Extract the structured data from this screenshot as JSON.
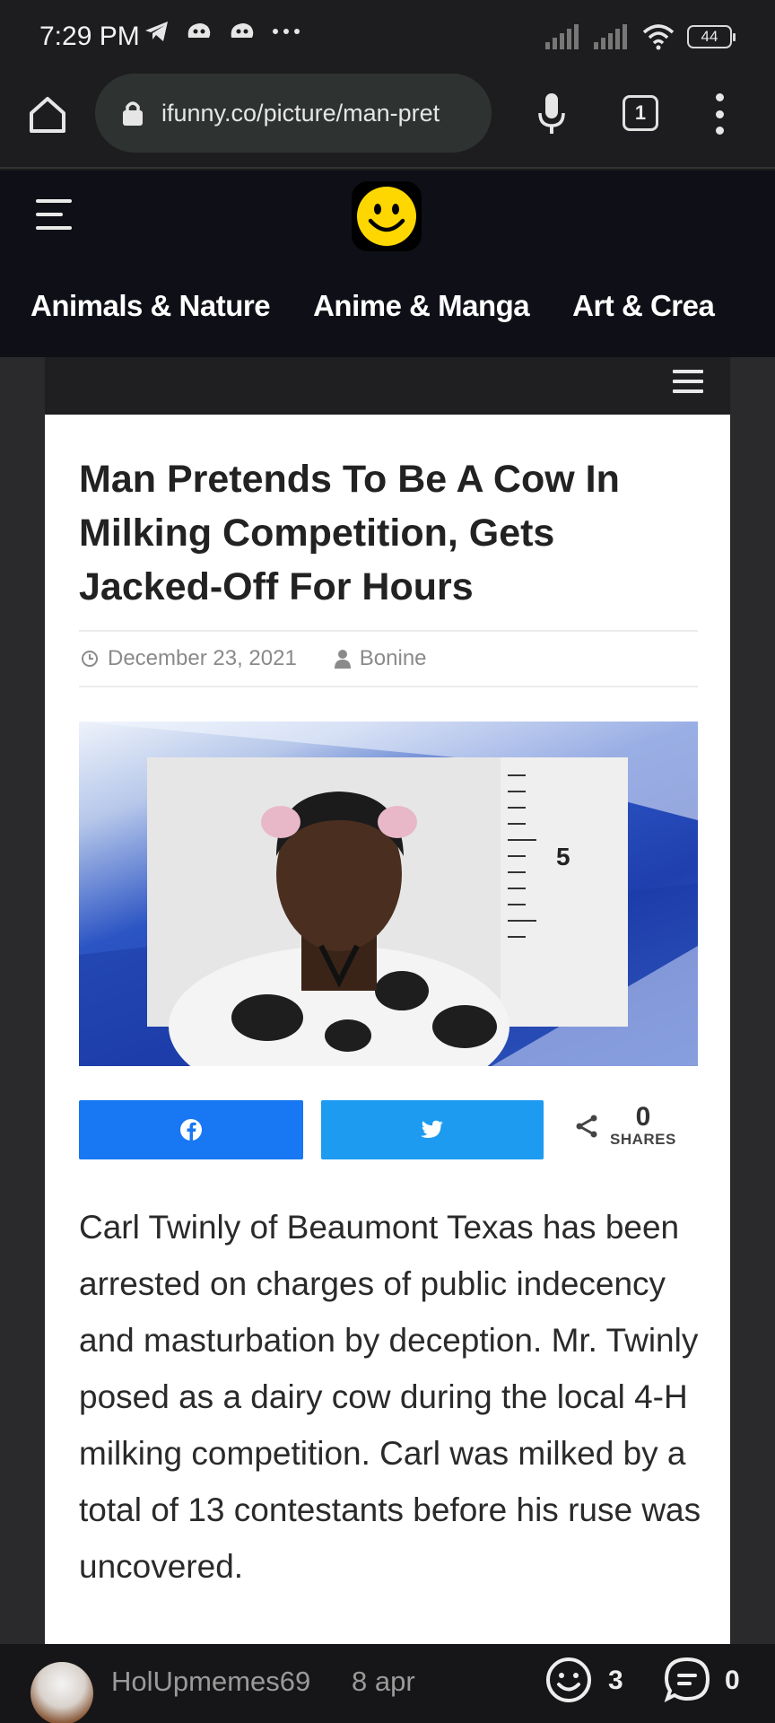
{
  "status_bar": {
    "time": "7:29 PM",
    "battery": "44"
  },
  "browser": {
    "url": "ifunny.co/picture/man-pret",
    "tab_count": "1"
  },
  "site": {
    "categories": [
      "Animals & Nature",
      "Anime & Manga",
      "Art & Crea"
    ],
    "accent_color": "#ffd700"
  },
  "article": {
    "headline": "Man Pretends To Be A Cow In Milking Competition, Gets Jacked-Off For Hours",
    "date": "December 23, 2021",
    "author": "Bonine",
    "share_count": "0",
    "share_label": "SHARES",
    "body": "Carl Twinly of Beaumont Texas has been arrested on charges of public indecency and masturbation by deception. Mr. Twinly posed as a dairy cow during the local 4-H milking competition. Carl was milked by a total of 13 contestants before his ruse was uncovered.",
    "mugshot_board": "5"
  },
  "comment_bar": {
    "username": "HolUpmemes69",
    "date": "8 apr",
    "smiles": "3",
    "comments": "0"
  },
  "colors": {
    "facebook": "#1877f2",
    "twitter": "#1d9bf0",
    "header_bg": "#0f0f17"
  }
}
